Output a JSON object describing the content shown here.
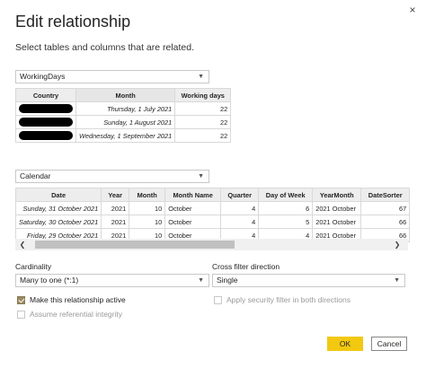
{
  "dialog": {
    "title": "Edit relationship",
    "subtitle": "Select tables and columns that are related.",
    "close_icon": "×"
  },
  "table1": {
    "selected": "WorkingDays",
    "columns": [
      "Country",
      "Month",
      "Working days"
    ],
    "rows": [
      {
        "country": "",
        "month": "Thursday, 1 July 2021",
        "days": "22"
      },
      {
        "country": "",
        "month": "Sunday, 1 August 2021",
        "days": "22"
      },
      {
        "country": "",
        "month": "Wednesday, 1 September 2021",
        "days": "22"
      }
    ]
  },
  "table2": {
    "selected": "Calendar",
    "columns": [
      "Date",
      "Year",
      "Month",
      "Month Name",
      "Quarter",
      "Day of Week",
      "YearMonth",
      "DateSorter"
    ],
    "rows": [
      [
        "Sunday, 31 October 2021",
        "2021",
        "10",
        "October",
        "4",
        "6",
        "2021 October",
        "67"
      ],
      [
        "Saturday, 30 October 2021",
        "2021",
        "10",
        "October",
        "4",
        "5",
        "2021 October",
        "66"
      ],
      [
        "Friday, 29 October 2021",
        "2021",
        "10",
        "October",
        "4",
        "4",
        "2021 October",
        "66"
      ]
    ]
  },
  "cardinality": {
    "label": "Cardinality",
    "value": "Many to one (*:1)"
  },
  "cross_filter": {
    "label": "Cross filter direction",
    "value": "Single"
  },
  "options": {
    "make_active": {
      "label": "Make this relationship active",
      "checked": true
    },
    "referential_integrity": {
      "label": "Assume referential integrity",
      "checked": false,
      "disabled": true
    },
    "security_filter": {
      "label": "Apply security filter in both directions",
      "checked": false,
      "disabled": true
    }
  },
  "buttons": {
    "ok": "OK",
    "cancel": "Cancel"
  },
  "colors": {
    "primary_button": "#f2c811",
    "checkbox_checked": "#9a8a60"
  }
}
